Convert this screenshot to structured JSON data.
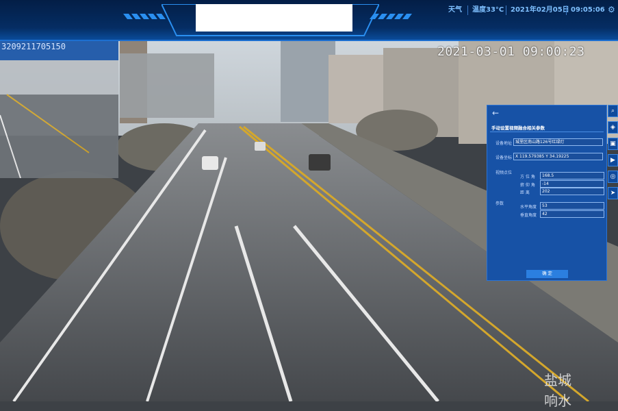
{
  "header": {
    "weather_label": "天气",
    "temperature": "温度33°C",
    "date": "2021年02月05日",
    "time": "09:05:06",
    "settings_icon": "gear-icon"
  },
  "video": {
    "timestamp": "2021-03-01 09:00:23",
    "watermark_line1": "盐城",
    "watermark_line2": "响水"
  },
  "pip": {
    "code": "3209211705150"
  },
  "params_panel": {
    "back_icon": "arrow-left-icon",
    "title": "手动设置视频融合相关参数",
    "device_address_label": "设备地址",
    "device_address_value": "城里区南山路126号红绿灯",
    "device_coords_label": "设备坐标",
    "device_coords_value": "X 119.579385  Y 34.19225",
    "video_point_label": "视频点位",
    "azimuth_label": "方 位 角",
    "azimuth_value": "168.5",
    "pitch_label": "俯 仰 角",
    "pitch_value": "-14",
    "distance_label": "距    离",
    "distance_value": "202",
    "params_label": "参数",
    "h_angle_label": "水平角度",
    "h_angle_value": "53",
    "v_angle_label": "垂直角度",
    "v_angle_value": "42",
    "confirm_label": "确    定"
  },
  "side_tools": [
    {
      "icon": "search-icon",
      "glyph": "⌕"
    },
    {
      "icon": "layers-icon",
      "glyph": "◈"
    },
    {
      "icon": "monitor-icon",
      "glyph": "▣"
    },
    {
      "icon": "camera-icon",
      "glyph": "▶"
    },
    {
      "icon": "globe-icon",
      "glyph": "◎"
    },
    {
      "icon": "send-icon",
      "glyph": "➤"
    }
  ]
}
